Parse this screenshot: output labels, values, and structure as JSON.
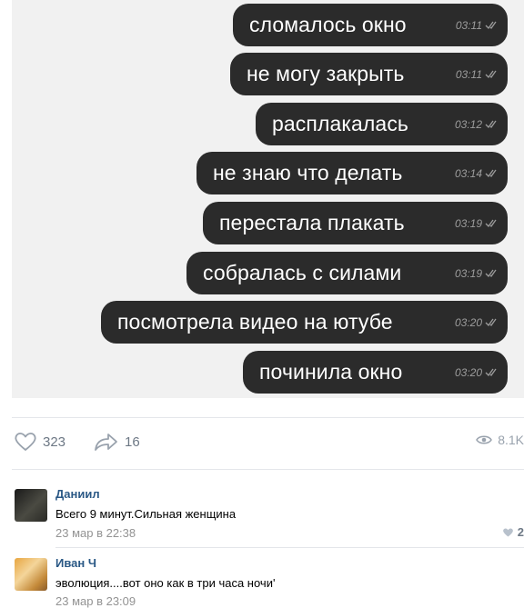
{
  "chat": {
    "messages": [
      {
        "text": "сломалось окно",
        "time": "03:11"
      },
      {
        "text": "не могу закрыть",
        "time": "03:11"
      },
      {
        "text": "расплакалась",
        "time": "03:12"
      },
      {
        "text": "не знаю что делать",
        "time": "03:14"
      },
      {
        "text": "перестала плакать",
        "time": "03:19"
      },
      {
        "text": "собралась с силами",
        "time": "03:19"
      },
      {
        "text": "посмотрела видео на ютубе",
        "time": "03:20"
      },
      {
        "text": "починила окно",
        "time": "03:20"
      }
    ],
    "colors": {
      "bubble": "#2b2b2b",
      "background": "#f1f1f1"
    },
    "read_icon": "double-check-icon"
  },
  "post": {
    "likes": "323",
    "shares": "16",
    "views": "8.1K",
    "icons": {
      "like": "heart-icon",
      "share": "share-arrow-icon",
      "views": "eye-icon"
    }
  },
  "comments": [
    {
      "author": "Даниил",
      "text": "Всего 9 минут.Сильная женщина",
      "date": "23 мар в 22:38",
      "likes": "2"
    },
    {
      "author": "Иван Ч",
      "text": "эволюция....вот оно как   в три часа ночи'",
      "date": "23 мар в 23:09"
    }
  ]
}
